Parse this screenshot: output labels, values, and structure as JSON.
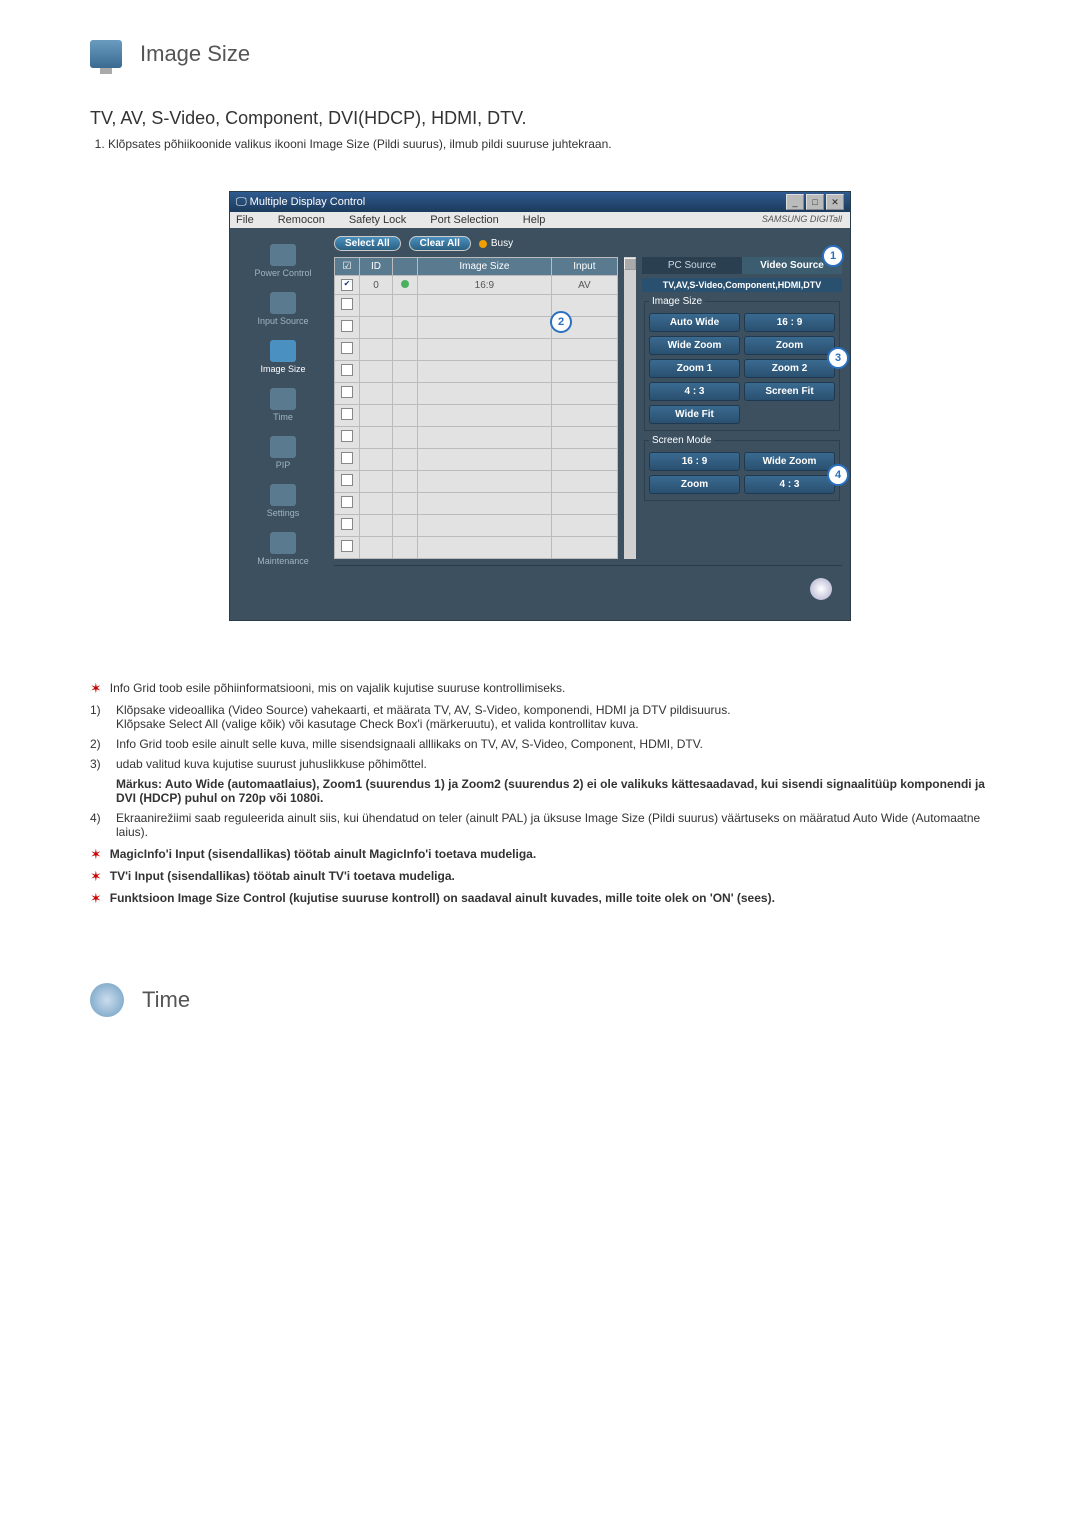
{
  "header1": {
    "title": "Image Size"
  },
  "subtitle": "TV, AV, S-Video, Component, DVI(HDCP), HDMI, DTV.",
  "intro_item": "Klõpsates põhiikoonide valikus ikooni Image Size (Pildi suurus), ilmub pildi suuruse juhtekraan.",
  "app": {
    "title": "Multiple Display Control",
    "win_min": "_",
    "win_max": "□",
    "win_close": "✕",
    "menu": [
      "File",
      "Remocon",
      "Safety Lock",
      "Port Selection",
      "Help"
    ],
    "brand": "SAMSUNG DIGITall",
    "select_all": "Select All",
    "clear_all": "Clear All",
    "busy": "Busy",
    "sidebar": [
      {
        "label": "Power Control"
      },
      {
        "label": "Input Source"
      },
      {
        "label": "Image Size"
      },
      {
        "label": "Time"
      },
      {
        "label": "PIP"
      },
      {
        "label": "Settings"
      },
      {
        "label": "Maintenance"
      }
    ],
    "columns": {
      "chk": "☑",
      "id": "ID",
      "status": " ",
      "image_size": "Image Size",
      "input": "Input"
    },
    "row": {
      "id": "0",
      "image_size": "16:9",
      "input": "AV"
    },
    "tabs": {
      "pc": "PC Source",
      "video": "Video Source"
    },
    "band": "TV,AV,S-Video,Component,HDMI,DTV",
    "pane1_title": "Image Size",
    "image_size_buttons": [
      "Auto Wide",
      "16 : 9",
      "Wide Zoom",
      "Zoom",
      "Zoom 1",
      "Zoom 2",
      "4 : 3",
      "Screen Fit",
      "Wide Fit"
    ],
    "pane2_title": "Screen Mode",
    "screen_mode_buttons": [
      "16 : 9",
      "Wide Zoom",
      "Zoom",
      "4 : 3"
    ],
    "badges": {
      "b1": "1",
      "b2": "2",
      "b3": "3",
      "b4": "4"
    }
  },
  "notes": {
    "star1": "Info Grid toob esile põhiinformatsiooni, mis on vajalik kujutise suuruse kontrollimiseks.",
    "n1a": "Klõpsake videoallika (Video Source) vahekaarti, et määrata TV, AV, S-Video, komponendi, HDMI ja DTV pildisuurus.",
    "n1b": "Klõpsake Select All (valige kõik) või kasutage Check Box'i (märkeruutu), et valida kontrollitav kuva.",
    "n2": "Info Grid toob esile ainult selle kuva, mille sisendsignaali alllikaks on TV, AV, S-Video, Component, HDMI, DTV.",
    "n3": "udab valitud kuva kujutise suurust juhuslikkuse põhimõttel.",
    "n3note": "Märkus: Auto Wide (automaatlaius), Zoom1 (suurendus 1) ja Zoom2 (suurendus 2) ei ole valikuks kättesaadavad, kui sisendi signaalitüüp komponendi ja DVI (HDCP) puhul on 720p või 1080i.",
    "n4": "Ekraanirežiimi saab reguleerida ainult siis, kui ühendatud on teler (ainult PAL) ja üksuse Image Size (Pildi suurus) väärtuseks on määratud Auto Wide (Automaatne laius).",
    "star2": "MagicInfo'i Input (sisendallikas) töötab ainult MagicInfo'i toetava mudeliga.",
    "star3": "TV'i Input (sisendallikas) töötab ainult TV'i toetava mudeliga.",
    "star4": "Funktsioon Image Size Control (kujutise suuruse kontroll) on saadaval ainult kuvades, mille toite olek on 'ON' (sees)."
  },
  "header2": {
    "title": "Time"
  }
}
